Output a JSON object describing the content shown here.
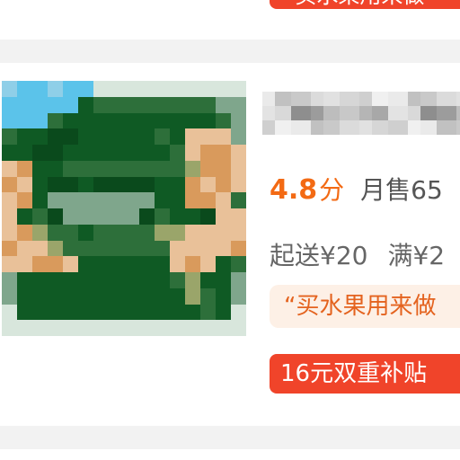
{
  "top_card": {
    "promo_text": "“买水果用来做"
  },
  "store": {
    "thumbnail": "store-thumbnail-image",
    "name": "",
    "rating_value": "4.8",
    "rating_unit": "分",
    "monthly_sales": "月售65",
    "min_order": "起送¥20",
    "discount_threshold": "满¥2",
    "review_quote": "“买水果用来做",
    "promo": "16元双重补贴"
  },
  "colors": {
    "accent_orange": "#f36a14",
    "promo_red": "#f0442a",
    "quote_bg": "#fdf0e6",
    "quote_text": "#e4631f"
  }
}
